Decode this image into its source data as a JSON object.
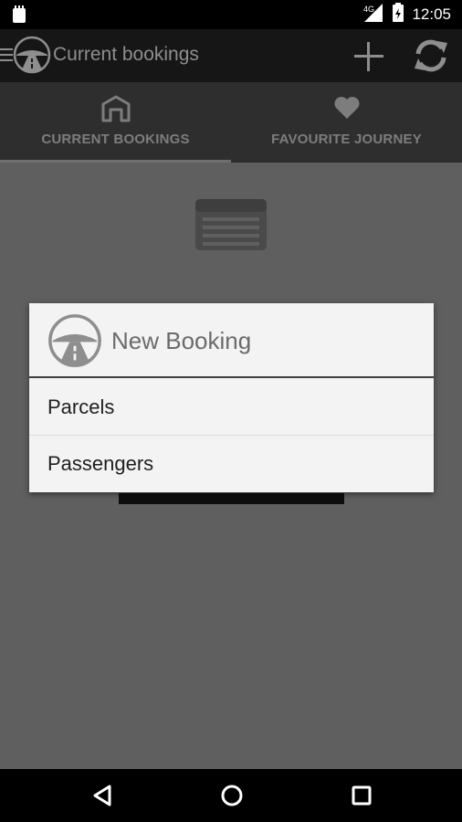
{
  "status_bar": {
    "time": "12:05",
    "network": "4G",
    "icons": [
      "notification-icon",
      "signal-icon",
      "battery-icon"
    ]
  },
  "app_bar": {
    "title": "Current bookings",
    "icons": [
      "menu-icon",
      "road-logo-icon",
      "plus-icon",
      "refresh-icon"
    ]
  },
  "tabs": [
    {
      "label": "CURRENT BOOKINGS",
      "icon": "building-icon",
      "selected": true
    },
    {
      "label": "FAVOURITE JOURNEY",
      "icon": "heart-icon",
      "selected": false
    }
  ],
  "content": {
    "empty_icon": "list-card-icon"
  },
  "dialog": {
    "title": "New Booking",
    "icon": "road-logo-icon",
    "items": [
      {
        "label": "Parcels"
      },
      {
        "label": "Passengers"
      }
    ]
  },
  "nav_bar": {
    "icons": [
      "back-icon",
      "home-icon",
      "recents-icon"
    ]
  },
  "colors": {
    "app_bar_bg": "#161616",
    "tabs_bg": "#2e2e2e",
    "content_bg": "#5f5f5f",
    "dialog_bg": "#f3f3f3"
  }
}
